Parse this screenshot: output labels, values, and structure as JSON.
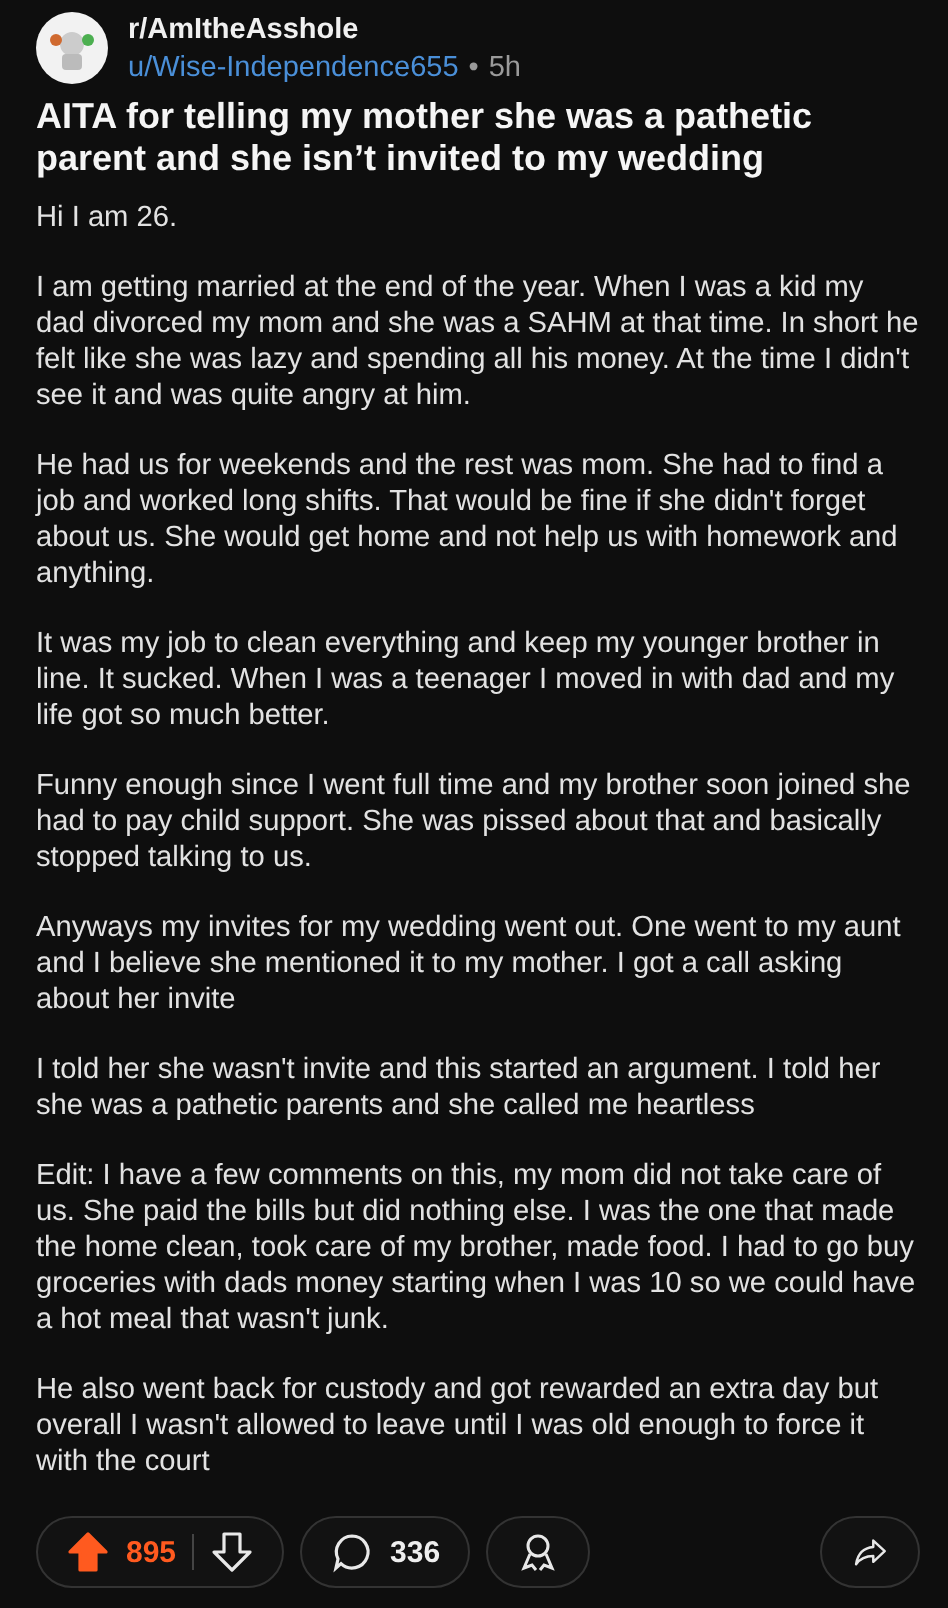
{
  "post": {
    "subreddit": "r/AmItheAsshole",
    "author": "u/Wise-Independence655",
    "separator": "•",
    "age": "5h",
    "title": "AITA for telling my mother she was a pathetic parent and she isn’t invited to my wedding",
    "paragraphs": [
      "Hi I am 26.",
      "I am getting married at the end of the year. When I was a kid my dad divorced my mom and she was a SAHM at that time. In short he felt like she was lazy and spending all his money. At the time I didn't see it and was quite angry at him.",
      "He had us for weekends and the rest was mom. She had to find a job and worked long shifts. That would be fine if she didn't forget about us. She would get home and not help us with homework and anything.",
      "It was my job to clean everything and keep my younger brother in line. It sucked. When I was a teenager I moved in with dad and my life got so much better.",
      "Funny enough since I went full time and my brother soon joined she had to pay child support. She was pissed about that and basically stopped talking to us.",
      "Anyways my invites for my wedding went out. One went to my aunt and I believe she mentioned it to my mother. I got a call asking about her invite",
      "I told her she wasn't invite and this started an argument. I told her she was a pathetic parents and she called me heartless",
      "Edit: I have a few comments on this, my mom did not take care of us. She paid the bills but did nothing else. I was the one that made the home clean, took care of my brother, made food. I had to go buy groceries with dads money starting when  I was 10 so we could have a hot meal that wasn't junk.",
      "He also went back for custody and got rewarded an extra day but overall I wasn't allowed to leave until I was old enough to force it with the court"
    ]
  },
  "actions": {
    "upvoted": true,
    "score": "895",
    "comments": "336"
  }
}
